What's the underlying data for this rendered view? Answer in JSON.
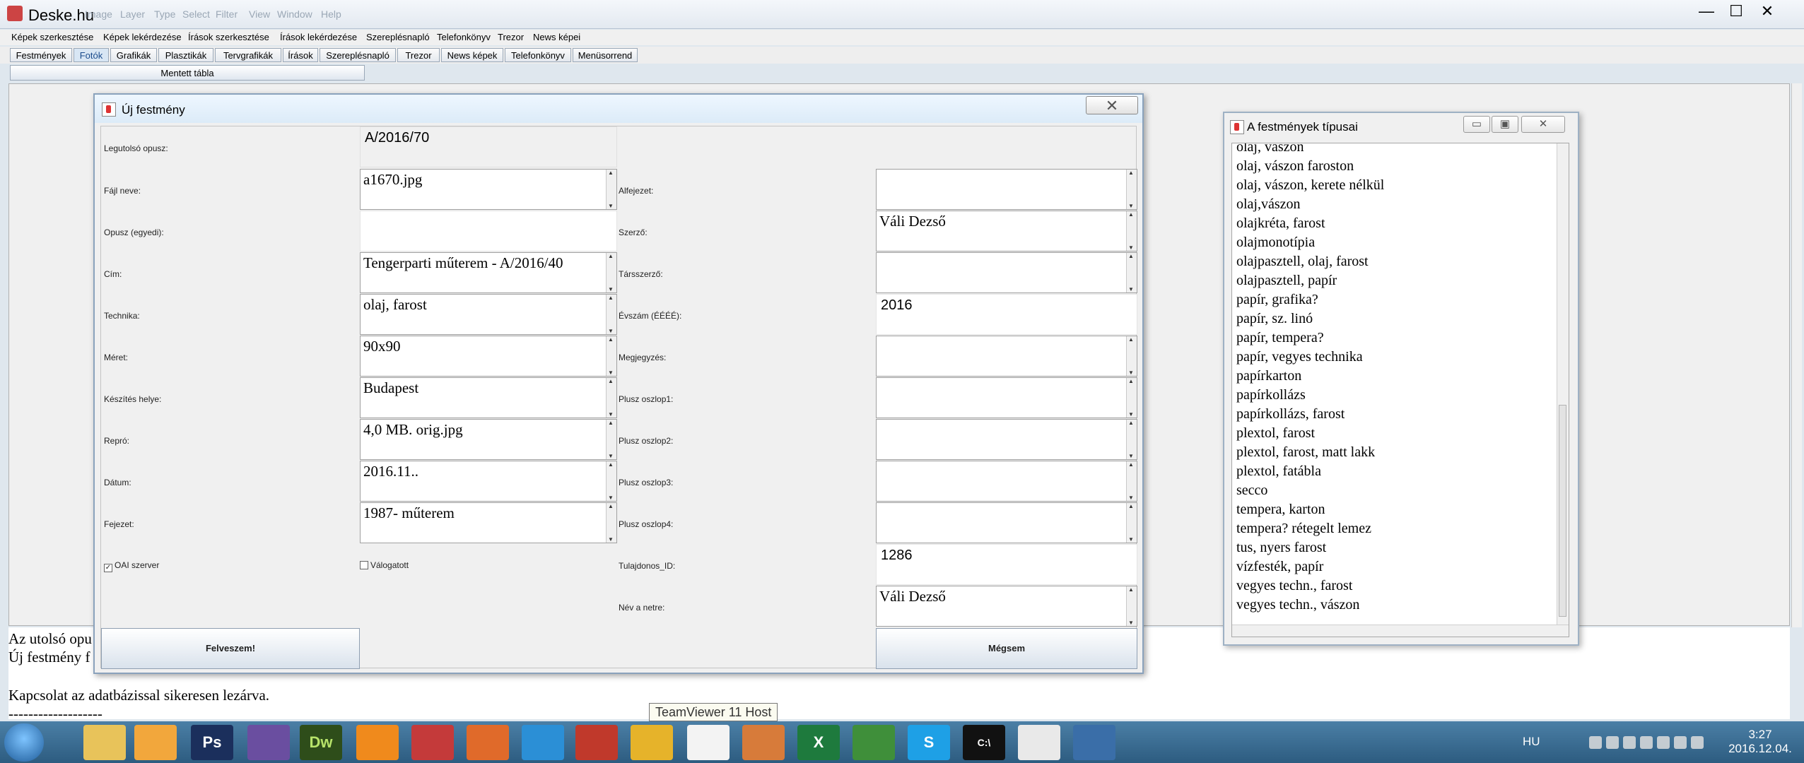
{
  "app": {
    "title": "Deske.hu",
    "ghost_menu": [
      "Image",
      "Layer",
      "Type",
      "Select",
      "Filter",
      "View",
      "Window",
      "Help"
    ],
    "window_buttons": {
      "minimize": "—",
      "maximize": "☐",
      "close": "✕"
    }
  },
  "menubar": [
    "Képek szerkesztése",
    "Képek lekérdezése",
    "Írások szerkesztése",
    "Írások lekérdezése",
    "Szereplésnapló",
    "Telefonkönyv",
    "Trezor",
    "News képei"
  ],
  "tabs": [
    "Festmények",
    "Fotók",
    "Grafikák",
    "Plasztikák",
    "Tervgrafikák",
    "Írások",
    "Szereplésnapló",
    "Trezor",
    "News képek",
    "Telefonkönyv",
    "Menüsorrend"
  ],
  "selected_tab": "Fotók",
  "saved_table_button": "Mentett tábla",
  "dialog": {
    "title": "Új festmény",
    "close_icon": "✕",
    "left_fields": [
      {
        "label": "Legutolsó opusz:",
        "value": "A/2016/70"
      },
      {
        "label": "Fájl neve:",
        "value": "a1670.jpg"
      },
      {
        "label": "Opusz (egyedi):",
        "value": ""
      },
      {
        "label": "Cím:",
        "value": "Tengerparti műterem - A/2016/40"
      },
      {
        "label": "Technika:",
        "value": "olaj, farost"
      },
      {
        "label": "Méret:",
        "value": "90x90"
      },
      {
        "label": "Készítés helye:",
        "value": "Budapest"
      },
      {
        "label": "Repró:",
        "value": "4,0 MB. orig.jpg"
      },
      {
        "label": "Dátum:",
        "value": "2016.11.."
      },
      {
        "label": "Fejezet:",
        "value": "1987- műterem"
      }
    ],
    "right_fields": [
      {
        "label": "Alfejezet:",
        "value": ""
      },
      {
        "label": "Szerző:",
        "value": "Váli Dezső"
      },
      {
        "label": "Társszerző:",
        "value": ""
      },
      {
        "label": "Évszám (ÉÉÉÉ):",
        "value": "2016"
      },
      {
        "label": "Megjegyzés:",
        "value": ""
      },
      {
        "label": "Plusz oszlop1:",
        "value": ""
      },
      {
        "label": "Plusz oszlop2:",
        "value": ""
      },
      {
        "label": "Plusz oszlop3:",
        "value": ""
      },
      {
        "label": "Plusz oszlop4:",
        "value": ""
      },
      {
        "label": "Tulajdonos_ID:",
        "value": "1286"
      },
      {
        "label": "Név a netre:",
        "value": "Váli Dezső"
      }
    ],
    "checkbox_oai": {
      "label": "OAI szerver",
      "checked": true,
      "mark": "✓"
    },
    "checkbox_valogatott": {
      "label": "Válogatott",
      "checked": false,
      "mark": ""
    },
    "ok_button": "Felveszem!",
    "cancel_button": "Mégsem"
  },
  "types_window": {
    "title": "A festmények típusai",
    "buttons": {
      "minimize": "▭",
      "maximize": "▣",
      "close": "✕"
    },
    "items": [
      "olaj, vászon",
      "olaj, vászon faroston",
      "olaj, vászon, kerete nélkül",
      "olaj,vászon",
      "olajkréta, farost",
      "olajmonotípia",
      "olajpasztell, olaj, farost",
      "olajpasztell, papír",
      "papír, grafika?",
      "papír, sz. linó",
      "papír, tempera?",
      "papír, vegyes technika",
      "papírkarton",
      "papírkollázs",
      "papírkollázs, farost",
      "plextol, farost",
      "plextol, farost, matt lakk",
      "plextol, fatábla",
      "secco",
      "tempera, karton",
      "tempera? rétegelt lemez",
      "tus, nyers farost",
      "vízfesték, papír",
      "vegyes techn., farost",
      "vegyes techn., vászon"
    ]
  },
  "log": {
    "line1": "Az utolsó opu",
    "line2": "Új festmény f",
    "line3": "Kapcsolat az adatbázissal sikeresen lezárva.",
    "line4": "-------------------"
  },
  "tooltip": "TeamViewer 11 Host",
  "taskbar": {
    "language": "HU",
    "time": "3:27",
    "date": "2016.12.04.",
    "icons": [
      "explorer-icon",
      "outlook-icon",
      "photoshop-icon",
      "visual-studio-icon",
      "dreamweaver-icon",
      "vlc-icon",
      "save-icon",
      "firefox-icon",
      "ie-icon",
      "filezilla-icon",
      "vector-icon",
      "calendar-icon",
      "paint-icon",
      "excel-icon",
      "chrome-icon",
      "skype-icon",
      "console-icon",
      "java-icon",
      "network-icon"
    ],
    "icon_labels": {
      "photoshop": "Ps",
      "dreamweaver": "Dw",
      "excel": "X",
      "skype": "S",
      "console": "C:\\"
    }
  }
}
